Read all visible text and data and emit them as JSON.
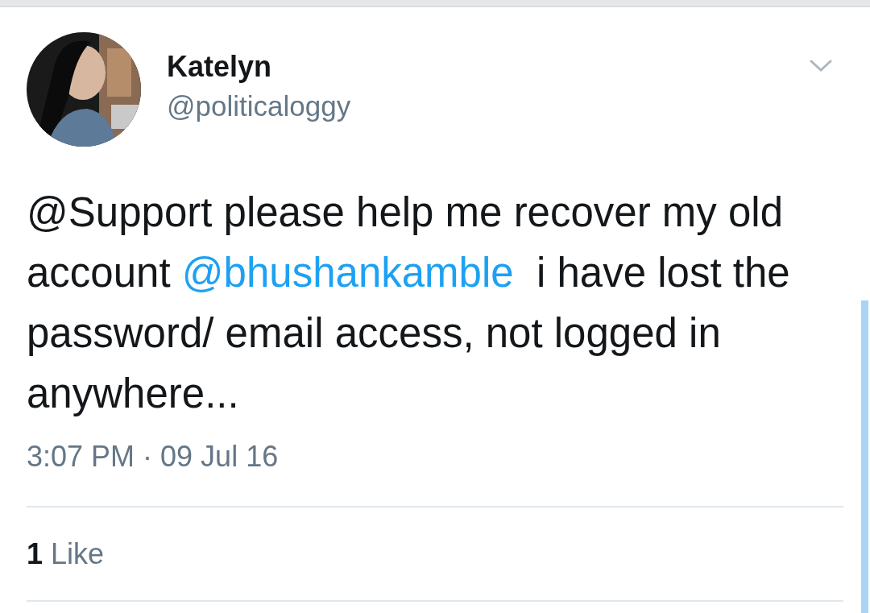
{
  "author": {
    "name": "Katelyn",
    "handle": "@politicaloggy"
  },
  "body": [
    {
      "kind": "text",
      "text": "@Support please help me recover my old account "
    },
    {
      "kind": "mention",
      "text": "@bhushankamble"
    },
    {
      "kind": "text",
      "text": "  i have lost the password/ email access, not logged in anywhere..."
    }
  ],
  "timestamp": "3:07 PM · 09 Jul 16",
  "likes": {
    "count": "1",
    "label": "Like"
  }
}
